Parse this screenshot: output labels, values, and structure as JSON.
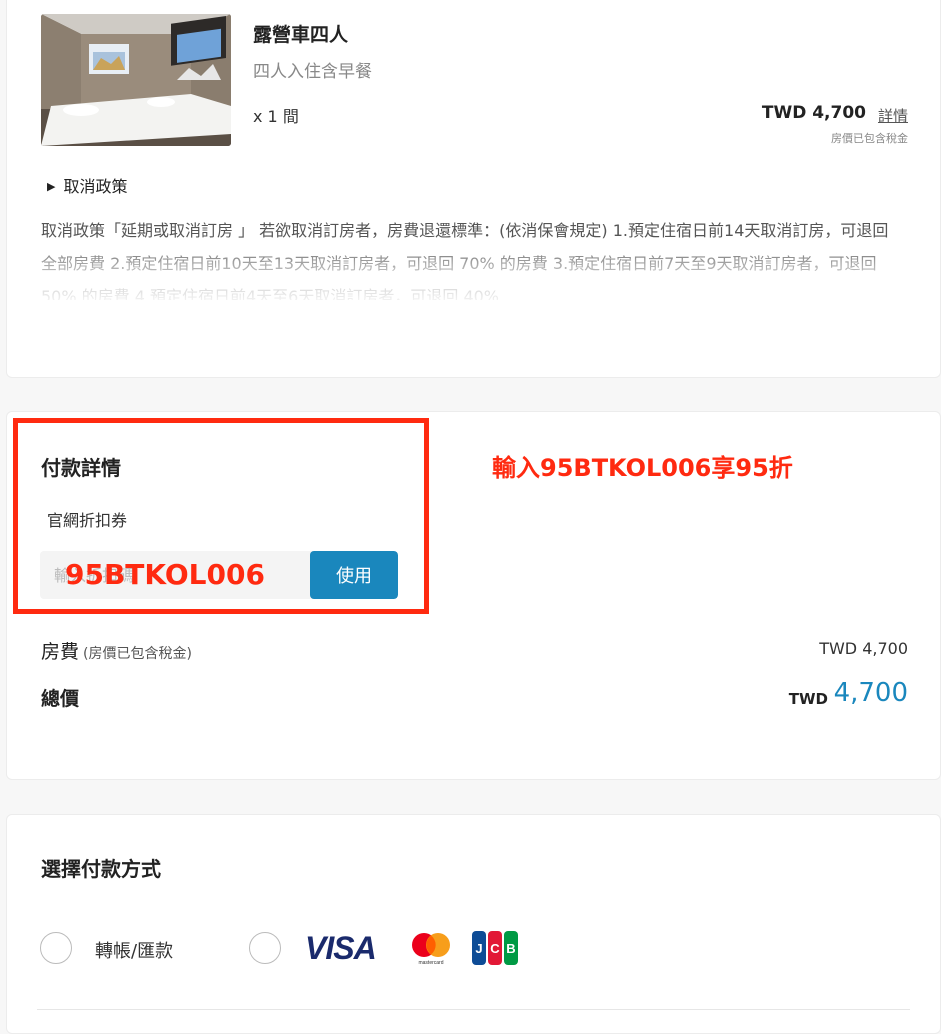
{
  "room": {
    "name": "露營車四人",
    "subtitle": "四人入住含早餐",
    "qty": "x 1 間",
    "price": "TWD 4,700",
    "detail_link": "詳情",
    "tax_note": "房價已包含稅金",
    "policy_toggle": "取消政策",
    "policy_text": "取消政策「延期或取消訂房 」 若欲取消訂房者，房費退還標準：(依消保會規定) 1.預定住宿日前14天取消訂房，可退回全部房費 2.預定住宿日前10天至13天取消訂房者，可退回 70% 的房費 3.預定住宿日前7天至9天取消訂房者，可退回 50% 的房費 4.預定住宿日前4天至6天取消訂房者，可退回 40%"
  },
  "payment": {
    "title": "付款詳情",
    "coupon_label": "官網折扣券",
    "coupon_placeholder": "輸入折扣碼",
    "use_button": "使用",
    "promo_overlay": "95BTKOL006",
    "promo_headline": "輸入95BTKOL006享95折",
    "fee_label": "房費",
    "fee_note": "(房價已包含稅金)",
    "fee_value": "TWD 4,700",
    "total_label": "總價",
    "total_currency": "TWD",
    "total_value": "4,700"
  },
  "method": {
    "title": "選擇付款方式",
    "options": [
      {
        "label": "轉帳/匯款"
      },
      {
        "label": "",
        "brands": [
          "VISA",
          "mastercard",
          "JCB"
        ]
      }
    ]
  },
  "colors": {
    "accent": "#1a87bd",
    "annotation_red": "#ff2a10",
    "visa_blue": "#1a2a6c"
  }
}
